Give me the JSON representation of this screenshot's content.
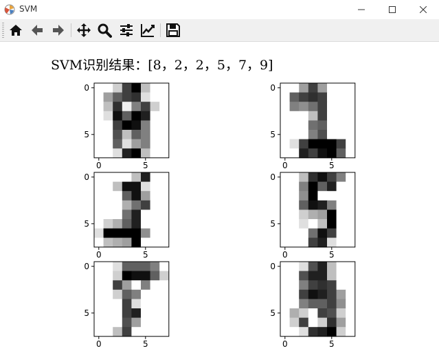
{
  "window": {
    "title": "SVM",
    "minimize_icon": "minimize-icon",
    "maximize_icon": "maximize-icon",
    "close_icon": "close-icon"
  },
  "toolbar": {
    "buttons": [
      "home-icon",
      "back-icon",
      "forward-icon",
      "pan-icon",
      "zoom-icon",
      "configure-subplots-icon",
      "edit-axis-icon",
      "save-icon"
    ]
  },
  "figure": {
    "title": "SVM识别结果：[8，2，2，5，7，9]"
  },
  "chart_data": {
    "type": "heatmap",
    "colormap": "gray_r",
    "value_range": [
      0,
      16
    ],
    "subplots": [
      {
        "xticks": [
          "0",
          "5"
        ],
        "yticks": [
          "0",
          "5"
        ],
        "values": [
          [
            0,
            0,
            3,
            12,
            16,
            4,
            0,
            0
          ],
          [
            0,
            6,
            10,
            12,
            13,
            2,
            0,
            0
          ],
          [
            0,
            4,
            13,
            1,
            8,
            12,
            3,
            0
          ],
          [
            0,
            2,
            15,
            10,
            16,
            14,
            0,
            0
          ],
          [
            0,
            0,
            12,
            16,
            15,
            8,
            0,
            0
          ],
          [
            0,
            0,
            11,
            4,
            10,
            8,
            0,
            0
          ],
          [
            0,
            0,
            10,
            2,
            6,
            8,
            0,
            0
          ],
          [
            0,
            0,
            2,
            14,
            16,
            4,
            0,
            0
          ]
        ]
      },
      {
        "xticks": [
          "0",
          "5"
        ],
        "yticks": [
          "0",
          "5"
        ],
        "values": [
          [
            0,
            0,
            6,
            12,
            6,
            0,
            0,
            0
          ],
          [
            0,
            10,
            12,
            13,
            12,
            0,
            0,
            0
          ],
          [
            0,
            8,
            7,
            9,
            12,
            0,
            0,
            0
          ],
          [
            0,
            0,
            0,
            4,
            12,
            0,
            0,
            0
          ],
          [
            0,
            0,
            0,
            9,
            10,
            0,
            0,
            0
          ],
          [
            0,
            0,
            0,
            8,
            11,
            0,
            0,
            0
          ],
          [
            0,
            2,
            12,
            16,
            16,
            16,
            12,
            0
          ],
          [
            0,
            0,
            14,
            12,
            15,
            16,
            10,
            0
          ]
        ]
      },
      {
        "xticks": [
          "0",
          "5"
        ],
        "yticks": [
          "0",
          "5"
        ],
        "values": [
          [
            0,
            0,
            0,
            0,
            4,
            14,
            0,
            0
          ],
          [
            0,
            0,
            4,
            15,
            15,
            2,
            0,
            0
          ],
          [
            0,
            0,
            0,
            10,
            15,
            6,
            0,
            0
          ],
          [
            0,
            0,
            0,
            5,
            9,
            12,
            0,
            0
          ],
          [
            0,
            0,
            0,
            9,
            14,
            0,
            0,
            0
          ],
          [
            0,
            3,
            5,
            10,
            14,
            0,
            0,
            0
          ],
          [
            2,
            16,
            16,
            16,
            16,
            7,
            0,
            0
          ],
          [
            0,
            4,
            5,
            6,
            16,
            0,
            0,
            0
          ]
        ]
      },
      {
        "xticks": [
          "0",
          "5"
        ],
        "yticks": [
          "0",
          "5"
        ],
        "values": [
          [
            0,
            0,
            4,
            13,
            15,
            12,
            8,
            0
          ],
          [
            0,
            0,
            8,
            16,
            10,
            14,
            0,
            0
          ],
          [
            0,
            0,
            7,
            16,
            0,
            0,
            0,
            0
          ],
          [
            0,
            0,
            10,
            15,
            14,
            8,
            0,
            0
          ],
          [
            0,
            0,
            3,
            5,
            6,
            16,
            0,
            0
          ],
          [
            0,
            0,
            2,
            0,
            4,
            16,
            0,
            0
          ],
          [
            0,
            0,
            0,
            9,
            15,
            12,
            0,
            0
          ],
          [
            0,
            0,
            0,
            12,
            14,
            2,
            0,
            0
          ]
        ]
      },
      {
        "xticks": [
          "0",
          "5"
        ],
        "yticks": [
          "0",
          "5"
        ],
        "values": [
          [
            0,
            0,
            2,
            10,
            10,
            10,
            8,
            0
          ],
          [
            0,
            0,
            3,
            16,
            15,
            15,
            10,
            3
          ],
          [
            0,
            0,
            12,
            6,
            0,
            8,
            0,
            0
          ],
          [
            0,
            0,
            3,
            10,
            8,
            0,
            0,
            0
          ],
          [
            0,
            0,
            0,
            12,
            2,
            0,
            0,
            0
          ],
          [
            0,
            0,
            0,
            12,
            14,
            0,
            0,
            0
          ],
          [
            0,
            0,
            0,
            11,
            6,
            0,
            0,
            0
          ],
          [
            0,
            0,
            4,
            12,
            0,
            0,
            0,
            0
          ]
        ]
      },
      {
        "xticks": [
          "0",
          "5"
        ],
        "yticks": [
          "0",
          "5"
        ],
        "values": [
          [
            0,
            0,
            2,
            11,
            14,
            4,
            0,
            0
          ],
          [
            0,
            0,
            11,
            14,
            14,
            4,
            0,
            0
          ],
          [
            0,
            0,
            8,
            12,
            13,
            12,
            0,
            0
          ],
          [
            0,
            0,
            12,
            15,
            14,
            12,
            6,
            0
          ],
          [
            0,
            0,
            8,
            10,
            10,
            12,
            7,
            0
          ],
          [
            0,
            5,
            3,
            0,
            12,
            11,
            3,
            0
          ],
          [
            0,
            3,
            12,
            0,
            3,
            13,
            6,
            0
          ],
          [
            0,
            0,
            2,
            13,
            14,
            16,
            3,
            0
          ]
        ]
      }
    ]
  }
}
